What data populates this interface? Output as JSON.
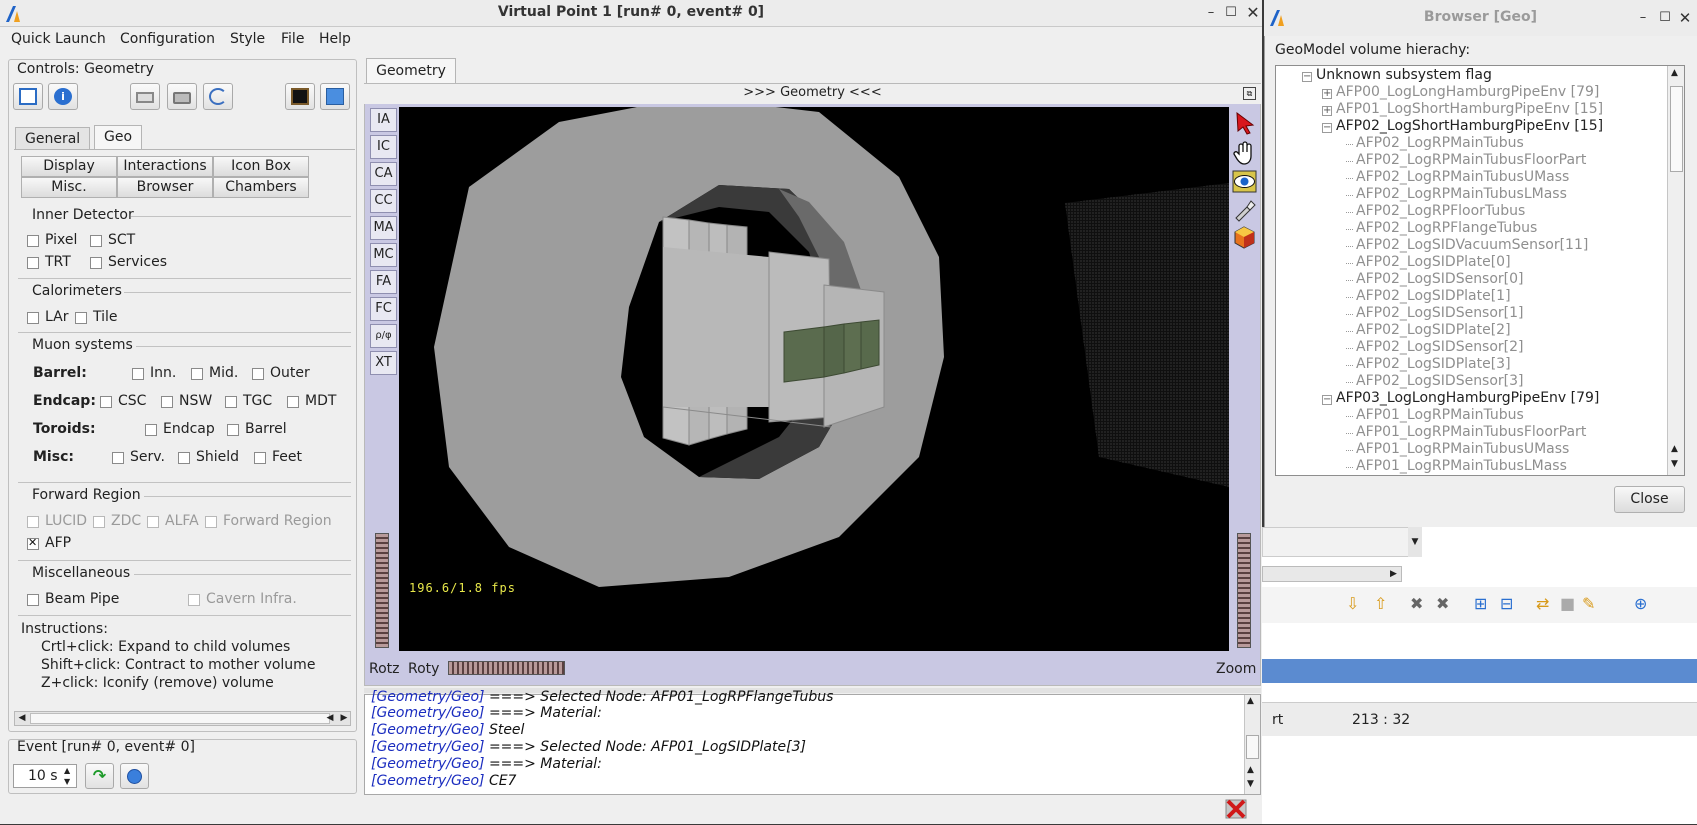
{
  "main_window": {
    "title": "Virtual Point 1 [run# 0, event# 0]",
    "menu": [
      "Quick Launch",
      "Configuration",
      "Style",
      "File",
      "Help"
    ]
  },
  "controls": {
    "title": "Controls: Geometry",
    "tabs": [
      "General",
      "Geo"
    ],
    "buttons_row1": [
      "Display",
      "Interactions",
      "Icon Box"
    ],
    "buttons_row2": [
      "Misc.",
      "Browser",
      "Chambers"
    ],
    "inner_detector": {
      "title": "Inner Detector",
      "items": [
        "Pixel",
        "SCT",
        "TRT",
        "Services"
      ]
    },
    "calorimeters": {
      "title": "Calorimeters",
      "items": [
        "LAr",
        "Tile"
      ]
    },
    "muon": {
      "title": "Muon systems",
      "barrel_label": "Barrel:",
      "barrel_items": [
        "Inn.",
        "Mid.",
        "Outer"
      ],
      "endcap_label": "Endcap:",
      "endcap_items": [
        "CSC",
        "NSW",
        "TGC",
        "MDT"
      ],
      "toroids_label": "Toroids:",
      "toroids_items": [
        "Endcap",
        "Barrel"
      ],
      "misc_label": "Misc:",
      "misc_items": [
        "Serv.",
        "Shield",
        "Feet"
      ]
    },
    "forward": {
      "title": "Forward Region",
      "items": [
        "LUCID",
        "ZDC",
        "ALFA",
        "Forward Region"
      ],
      "afp": "AFP",
      "afp_checked": true
    },
    "miscellaneous": {
      "title": "Miscellaneous",
      "items": [
        "Beam Pipe",
        "Cavern Infra."
      ]
    },
    "instructions": {
      "title": "Instructions:",
      "lines": [
        "Crtl+click: Expand to child volumes",
        "Shift+click: Contract to mother volume",
        "Z+click: Iconify (remove) volume"
      ]
    }
  },
  "event": {
    "title": "Event [run# 0, event# 0]",
    "interval": "10 s"
  },
  "geometry": {
    "tab": "Geometry",
    "header": ">>> Geometry <<<",
    "side_buttons": [
      "IA",
      "IC",
      "CA",
      "CC",
      "MA",
      "MC",
      "FA",
      "FC",
      "ρ/φ",
      "XT"
    ],
    "fps": "196.6/1.8 fps",
    "rotz": "Rotz",
    "roty": "Roty",
    "zoom": "Zoom"
  },
  "log": [
    {
      "src": "[Geometry/Geo]",
      "text": "===> Selected Node: AFP01_LogRPFlangeTubus"
    },
    {
      "src": "[Geometry/Geo]",
      "text": "===> Material:"
    },
    {
      "src": "[Geometry/Geo]",
      "text": "Steel"
    },
    {
      "src": "[Geometry/Geo]",
      "text": "===> Selected Node: AFP01_LogSIDPlate[3]"
    },
    {
      "src": "[Geometry/Geo]",
      "text": "===> Material:"
    },
    {
      "src": "[Geometry/Geo]",
      "text": "CE7"
    }
  ],
  "browser": {
    "title": "Browser [Geo]",
    "label": "GeoModel volume hierachy:",
    "close": "Close",
    "tree": [
      {
        "text": "Unknown subsystem flag",
        "level": 0,
        "expander": "minus",
        "dark": true
      },
      {
        "text": "AFP00_LogLongHamburgPipeEnv [79]",
        "level": 1,
        "expander": "plus",
        "dark": false
      },
      {
        "text": "AFP01_LogShortHamburgPipeEnv [15]",
        "level": 1,
        "expander": "plus",
        "dark": false
      },
      {
        "text": "AFP02_LogShortHamburgPipeEnv [15]",
        "level": 1,
        "expander": "minus",
        "dark": true
      },
      {
        "text": "AFP02_LogRPMainTubus",
        "level": 2,
        "dark": false
      },
      {
        "text": "AFP02_LogRPMainTubusFloorPart",
        "level": 2,
        "dark": false
      },
      {
        "text": "AFP02_LogRPMainTubusUMass",
        "level": 2,
        "dark": false
      },
      {
        "text": "AFP02_LogRPMainTubusLMass",
        "level": 2,
        "dark": false
      },
      {
        "text": "AFP02_LogRPFloorTubus",
        "level": 2,
        "dark": false
      },
      {
        "text": "AFP02_LogRPFlangeTubus",
        "level": 2,
        "dark": false
      },
      {
        "text": "AFP02_LogSIDVacuumSensor[11]",
        "level": 2,
        "dark": false
      },
      {
        "text": "AFP02_LogSIDPlate[0]",
        "level": 2,
        "dark": false
      },
      {
        "text": "AFP02_LogSIDSensor[0]",
        "level": 2,
        "dark": false
      },
      {
        "text": "AFP02_LogSIDPlate[1]",
        "level": 2,
        "dark": false
      },
      {
        "text": "AFP02_LogSIDSensor[1]",
        "level": 2,
        "dark": false
      },
      {
        "text": "AFP02_LogSIDPlate[2]",
        "level": 2,
        "dark": false
      },
      {
        "text": "AFP02_LogSIDSensor[2]",
        "level": 2,
        "dark": false
      },
      {
        "text": "AFP02_LogSIDPlate[3]",
        "level": 2,
        "dark": false
      },
      {
        "text": "AFP02_LogSIDSensor[3]",
        "level": 2,
        "dark": false
      },
      {
        "text": "AFP03_LogLongHamburgPipeEnv [79]",
        "level": 1,
        "expander": "minus",
        "dark": true
      },
      {
        "text": "AFP01_LogRPMainTubus",
        "level": 2,
        "dark": false
      },
      {
        "text": "AFP01_LogRPMainTubusFloorPart",
        "level": 2,
        "dark": false
      },
      {
        "text": "AFP01_LogRPMainTubusUMass",
        "level": 2,
        "dark": false
      },
      {
        "text": "AFP01_LogRPMainTubusLMass",
        "level": 2,
        "dark": false
      }
    ]
  },
  "background_app": {
    "position": "213 : 32",
    "fragment": "rt"
  },
  "colors": {
    "viewer_bg": "#000000",
    "frame_bg": "#c9c8e3",
    "log_source": "#1b2dbf",
    "detector": "#aaaaaa",
    "sensor": "#5a6b4e"
  }
}
